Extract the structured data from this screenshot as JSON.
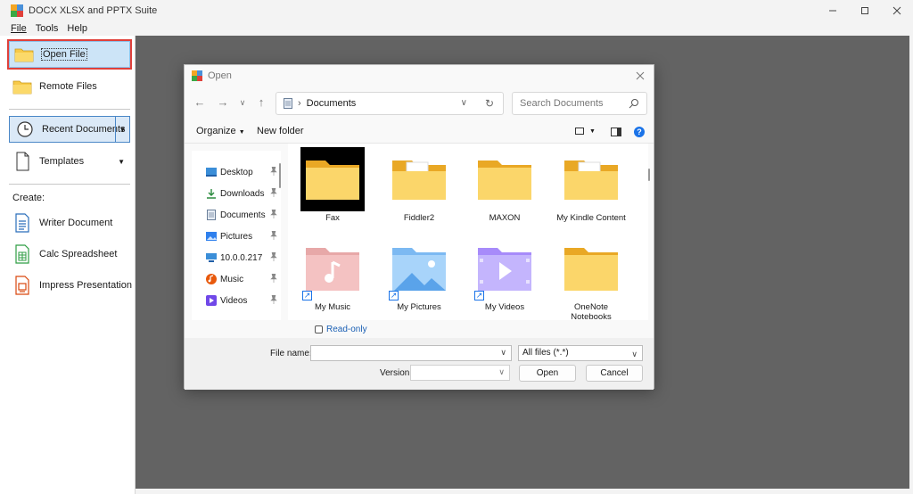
{
  "window": {
    "title": "DOCX XLSX and PPTX Suite"
  },
  "menu": [
    {
      "label": "File"
    },
    {
      "label": "Tools"
    },
    {
      "label": "Help"
    }
  ],
  "left_panel": {
    "open_file": "Open File",
    "remote_files": "Remote Files",
    "recent_documents": "Recent Documents",
    "templates": "Templates",
    "create_label": "Create:",
    "writer": "Writer Document",
    "calc": "Calc Spreadsheet",
    "impress": "Impress Presentation"
  },
  "dialog": {
    "title": "Open",
    "breadcrumb": "Documents",
    "search_placeholder": "Search Documents",
    "organize": "Organize",
    "new_folder": "New folder",
    "nav_items": [
      {
        "label": "Desktop",
        "icon": "desktop-icon"
      },
      {
        "label": "Downloads",
        "icon": "downloads-icon"
      },
      {
        "label": "Documents",
        "icon": "documents-icon"
      },
      {
        "label": "Pictures",
        "icon": "pictures-icon"
      },
      {
        "label": "10.0.0.217",
        "icon": "network-icon"
      },
      {
        "label": "Music",
        "icon": "music-icon"
      },
      {
        "label": "Videos",
        "icon": "videos-icon"
      }
    ],
    "files": [
      {
        "name": "Fax",
        "icon": "folder-icon",
        "selected": true
      },
      {
        "name": "Fiddler2",
        "icon": "folder-documents-icon"
      },
      {
        "name": "MAXON",
        "icon": "folder-icon"
      },
      {
        "name": "My Kindle Content",
        "icon": "folder-gear-icon"
      },
      {
        "name": "My Music",
        "icon": "music-folder-icon",
        "shortcut": true
      },
      {
        "name": "My Pictures",
        "icon": "pictures-folder-icon",
        "shortcut": true
      },
      {
        "name": "My Videos",
        "icon": "videos-folder-icon",
        "shortcut": true
      },
      {
        "name": "OneNote Notebooks",
        "icon": "folder-icon"
      }
    ],
    "read_only": "Read-only",
    "file_name_label": "File name:",
    "file_name_value": "",
    "filter": "All files (*.*)",
    "version_label": "Version:",
    "version_value": "",
    "open_button": "Open",
    "cancel_button": "Cancel"
  },
  "colors": {
    "folder": "#f7c948",
    "selection_border": "#e0403a",
    "accent": "#1a73e8",
    "background_main": "#636363"
  }
}
